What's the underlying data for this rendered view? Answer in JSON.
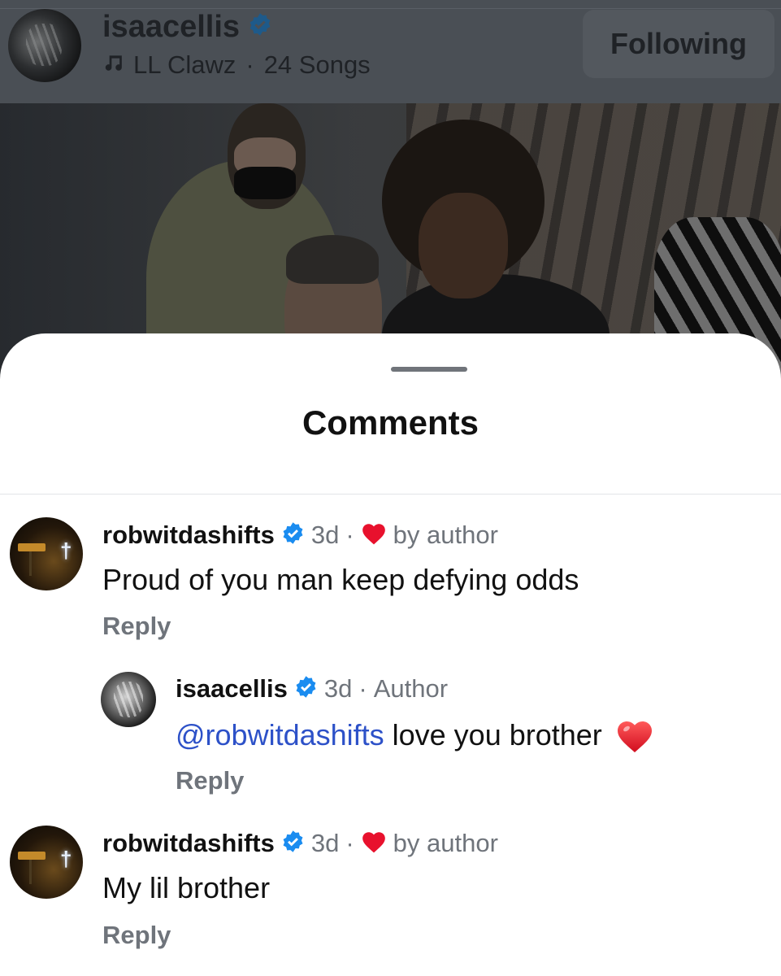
{
  "header": {
    "username": "isaacellis",
    "music_note_icon": "music-note-icon",
    "song_artist": "LL Clawz",
    "separator": "·",
    "song_count": "24 Songs",
    "follow_button": "Following"
  },
  "sheet": {
    "title": "Comments"
  },
  "comments": [
    {
      "username": "robwitdashifts",
      "time": "3d",
      "sep": "·",
      "liked_label": "by author",
      "text": "Proud of you man keep defying odds",
      "reply": "Reply"
    },
    {
      "username": "isaacellis",
      "time": "3d",
      "sep": "·",
      "role": "Author",
      "mention": "@robwitdashifts",
      "text": " love you brother",
      "emoji": "❤️",
      "reply": "Reply"
    },
    {
      "username": "robwitdashifts",
      "time": "3d",
      "sep": "·",
      "liked_label": "by author",
      "text": "My lil brother",
      "reply": "Reply"
    }
  ],
  "colors": {
    "verified": "#1a8cf0",
    "heart": "#e8112d",
    "mention": "#2d51c8",
    "muted_text": "#6f747b"
  }
}
